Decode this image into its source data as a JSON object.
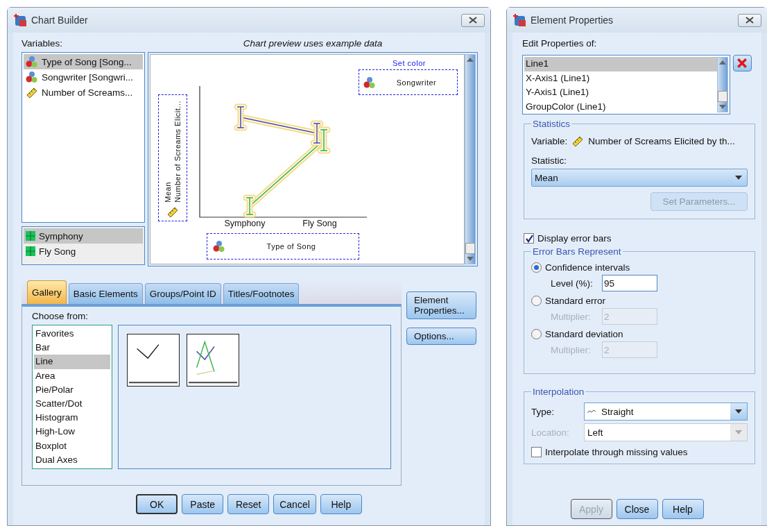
{
  "chart_builder": {
    "title": "Chart Builder",
    "variables_label": "Variables:",
    "variables": [
      {
        "label": "Type of Song [Song...",
        "kind": "nominal",
        "selected": true
      },
      {
        "label": "Songwriter [Songwri...",
        "kind": "nominal",
        "selected": false
      },
      {
        "label": "Number of Screams...",
        "kind": "scale",
        "selected": false
      }
    ],
    "categories": [
      {
        "label": "Symphony",
        "selected": true
      },
      {
        "label": "Fly Song",
        "selected": false
      }
    ],
    "preview_caption": "Chart preview uses example data",
    "preview": {
      "set_color_label": "Set color",
      "legend_variable": "Songwriter",
      "y_axis_label": "Mean",
      "y_axis_variable": "Number of Screams Elicit...",
      "x_categories": [
        "Symphony",
        "Fly Song"
      ],
      "x_axis_variable": "Type of Song"
    },
    "tabs": [
      {
        "label": "Gallery",
        "selected": true
      },
      {
        "label": "Basic Elements",
        "selected": false
      },
      {
        "label": "Groups/Point ID",
        "selected": false
      },
      {
        "label": "Titles/Footnotes",
        "selected": false
      }
    ],
    "choose_from_label": "Choose from:",
    "chart_types": [
      {
        "label": "Favorites",
        "selected": false
      },
      {
        "label": "Bar",
        "selected": false
      },
      {
        "label": "Line",
        "selected": true
      },
      {
        "label": "Area",
        "selected": false
      },
      {
        "label": "Pie/Polar",
        "selected": false
      },
      {
        "label": "Scatter/Dot",
        "selected": false
      },
      {
        "label": "Histogram",
        "selected": false
      },
      {
        "label": "High-Low",
        "selected": false
      },
      {
        "label": "Boxplot",
        "selected": false
      },
      {
        "label": "Dual Axes",
        "selected": false
      }
    ],
    "gallery": [
      {
        "kind": "simple"
      },
      {
        "kind": "multiple"
      }
    ],
    "side_buttons": [
      "Element Properties...",
      "Options..."
    ],
    "buttons": [
      {
        "label": "OK",
        "default": true
      },
      {
        "label": "Paste",
        "default": false
      },
      {
        "label": "Reset",
        "default": false
      },
      {
        "label": "Cancel",
        "default": false
      },
      {
        "label": "Help",
        "default": false
      }
    ]
  },
  "element_properties": {
    "title": "Element Properties",
    "edit_label": "Edit Properties of:",
    "elements": [
      {
        "label": "Line1",
        "selected": true
      },
      {
        "label": "X-Axis1 (Line1)",
        "selected": false
      },
      {
        "label": "Y-Axis1 (Line1)",
        "selected": false
      },
      {
        "label": "GroupColor (Line1)",
        "selected": false
      }
    ],
    "statistics": {
      "legend": "Statistics",
      "variable_label": "Variable:",
      "variable": "Number of Screams Elicited by th...",
      "statistic_label": "Statistic:",
      "statistic": "Mean",
      "set_parameters": {
        "label": "Set Parameters...",
        "disabled": true
      }
    },
    "display_error_bars": {
      "label": "Display error bars",
      "checked": true
    },
    "error_bars": {
      "legend": "Error Bars Represent",
      "options": [
        {
          "label": "Confidence intervals",
          "selected": true,
          "field_label": "Level (%):",
          "field_value": "95"
        },
        {
          "label": "Standard error",
          "selected": false,
          "field_label": "Multiplier:",
          "field_value": "2"
        },
        {
          "label": "Standard deviation",
          "selected": false,
          "field_label": "Multiplier:",
          "field_value": "2"
        }
      ]
    },
    "interpolation": {
      "legend": "Interpolation",
      "type_label": "Type:",
      "type": "Straight",
      "location_label": "Location:",
      "location": "Left",
      "location_disabled": true,
      "missing": {
        "label": "Interpolate through missing values",
        "checked": false
      }
    },
    "buttons": [
      {
        "label": "Apply",
        "disabled": true
      },
      {
        "label": "Close",
        "disabled": false
      },
      {
        "label": "Help",
        "disabled": false
      }
    ]
  }
}
